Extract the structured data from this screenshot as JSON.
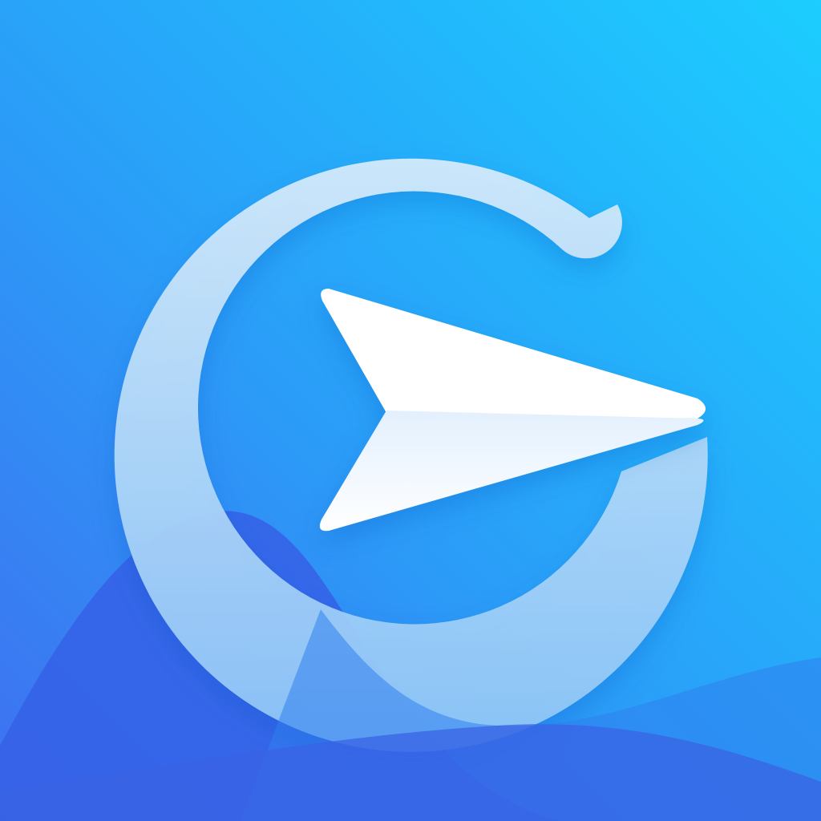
{
  "icon": {
    "name": "paper-plane-g-logo",
    "shapes": [
      "g-ring",
      "paper-plane",
      "wave-hills"
    ]
  },
  "colors": {
    "bg_top_right": "#1ccdff",
    "bg_mid": "#2a9ef8",
    "bg_bottom_left": "#3f6ff0",
    "ring_top": "#d9ecfb",
    "ring_bottom": "#8fc7f7",
    "plane_front": "#ffffff",
    "plane_back": "#f2f7ff",
    "wave_dark": "#3560e6",
    "wave_mid": "#2f80ee",
    "wave_front": "#2b7ae3"
  }
}
